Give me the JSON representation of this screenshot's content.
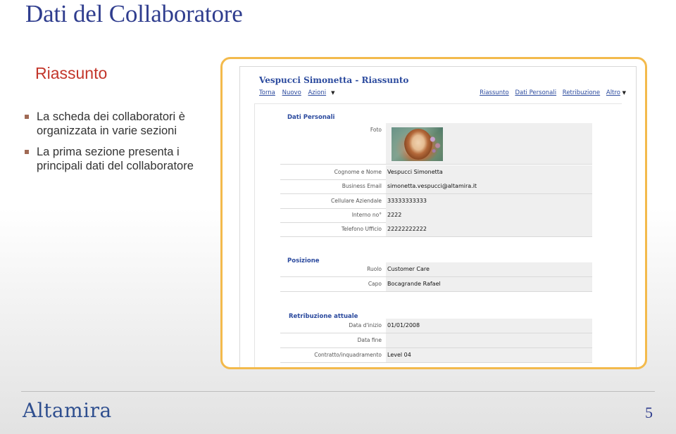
{
  "slide": {
    "title": "Dati del Collaboratore",
    "section": "Riassunto",
    "bullets": [
      "La scheda dei collaboratori è organizzata in varie sezioni",
      "La prima sezione presenta i principali dati del collaboratore"
    ],
    "page_number": "5",
    "logo_text": "Altamira"
  },
  "app": {
    "title": "Vespucci Simonetta - Riassunto",
    "nav_left": [
      "Torna",
      "Nuovo",
      "Azioni"
    ],
    "nav_right": [
      "Riassunto",
      "Dati Personali",
      "Retribuzione",
      "Altro"
    ],
    "caret": "▼",
    "sections": {
      "personal": {
        "label": "Dati Personali",
        "photo_label": "Foto",
        "rows": [
          {
            "label": "Cognome e Nome",
            "value": "Vespucci Simonetta"
          },
          {
            "label": "Business Email",
            "value": "simonetta.vespucci@altamira.it"
          },
          {
            "label": "Cellulare Aziendale",
            "value": "33333333333"
          },
          {
            "label": "Interno no°",
            "value": "2222"
          },
          {
            "label": "Telefono Ufficio",
            "value": "22222222222"
          }
        ]
      },
      "position": {
        "label": "Posizione",
        "rows": [
          {
            "label": "Ruolo",
            "value": "Customer Care"
          },
          {
            "label": "Capo",
            "value": "Bocagrande Rafael"
          }
        ]
      },
      "salary": {
        "label": "Retribuzione attuale",
        "rows": [
          {
            "label": "Data d'inizio",
            "value": "01/01/2008"
          },
          {
            "label": "Data fine",
            "value": ""
          },
          {
            "label": "Contratto/inquadramento",
            "value": "Level 04"
          }
        ]
      }
    }
  },
  "colors": {
    "title_blue": "#2f3d8e",
    "heading_red": "#c3362b",
    "frame_orange": "#f3ba4c",
    "link_blue": "#2b4a9e"
  }
}
